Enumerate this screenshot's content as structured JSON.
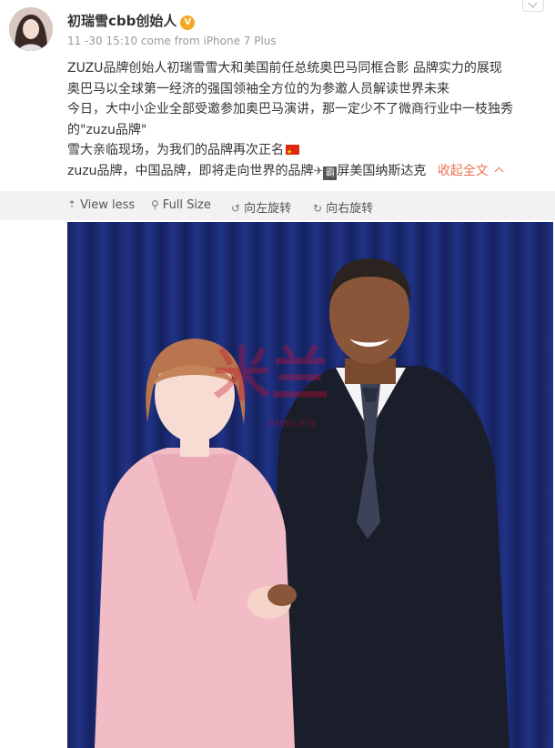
{
  "post": {
    "author": "初瑞雪cbb创始人",
    "timestamp": "11 -30 15:10",
    "source": "come from iPhone 7 Plus",
    "lines": [
      "ZUZU品牌创始人初瑞雪雪大和美国前任总统奥巴马同框合影 品牌实力的展现",
      "奥巴马以全球第一经济的强国领袖全方位的为参邀人员解读世界未来",
      "今日，大中小企业全部受邀参加奥巴马演讲，那一定少不了微商行业中一枝独秀",
      "的\"zuzu品牌\"",
      "雪大亲临现场，为我们的品牌再次正名",
      "zuzu品牌，中国品牌，即将走向世界的品牌",
      "屏美国纳斯达克"
    ],
    "collapse_label": "收起全文"
  },
  "toolbar": {
    "view_less": "View less",
    "full_size": "Full Size",
    "rotate_left": "向左旋转",
    "rotate_right": "向右旋转"
  },
  "photo": {
    "watermark_text": "米兰",
    "watermark_url": "www.ma"
  },
  "icons": [
    "vip-badge-icon",
    "china-flag-icon",
    "airplane-icon",
    "ba-icon",
    "chevron-up-icon",
    "view-less-icon",
    "search-icon",
    "rotate-left-icon",
    "rotate-right-icon",
    "more-chevron-icon"
  ],
  "colors": {
    "link": "#eb7350",
    "toolbar_bg": "#f2f2f5",
    "backdrop": "#1a2868",
    "coat": "#f2bcc6"
  }
}
